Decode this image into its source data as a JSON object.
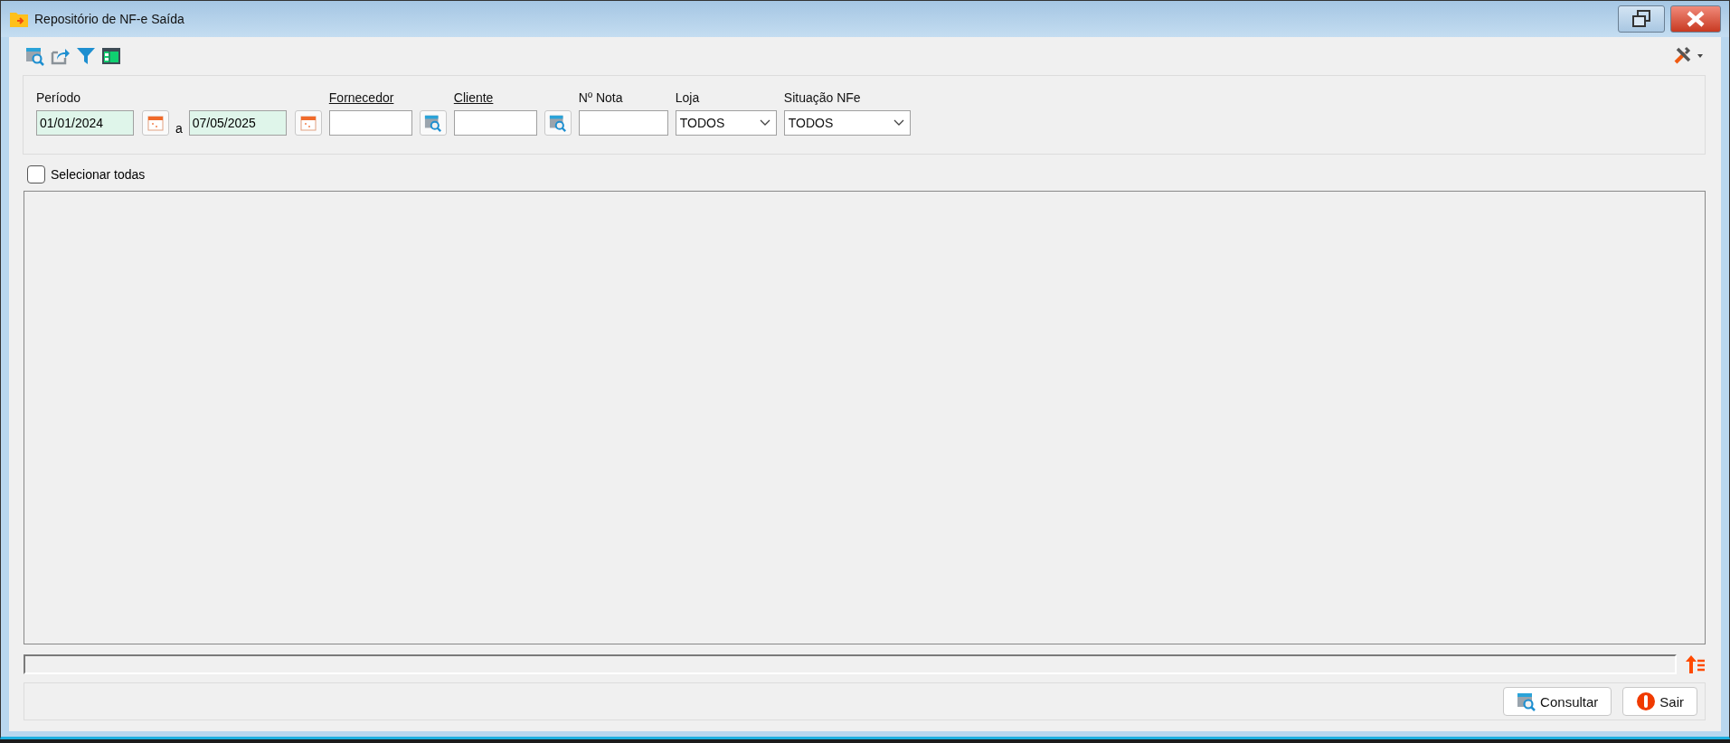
{
  "window": {
    "title": "Repositório de NF-e Saída"
  },
  "filters": [
    {
      "kind": "date-range",
      "label": "Período",
      "underlined": false,
      "from": "01/01/2024",
      "separator": "a",
      "to": "07/05/2025"
    },
    {
      "kind": "lookup",
      "label": "Fornecedor",
      "underlined": true
    },
    {
      "kind": "lookup",
      "label": "Cliente",
      "underlined": true
    },
    {
      "kind": "text",
      "label": "Nº Nota",
      "underlined": false
    },
    {
      "kind": "select",
      "label": "Loja",
      "underlined": false,
      "value": "TODOS"
    },
    {
      "kind": "select",
      "label": "Situação NFe",
      "underlined": false,
      "value": "TODOS"
    }
  ],
  "select_all": {
    "label": "Selecionar todas",
    "checked": false
  },
  "buttons": [
    {
      "kind": "search",
      "label": "Consultar"
    },
    {
      "kind": "exit",
      "label": "Sair"
    }
  ]
}
